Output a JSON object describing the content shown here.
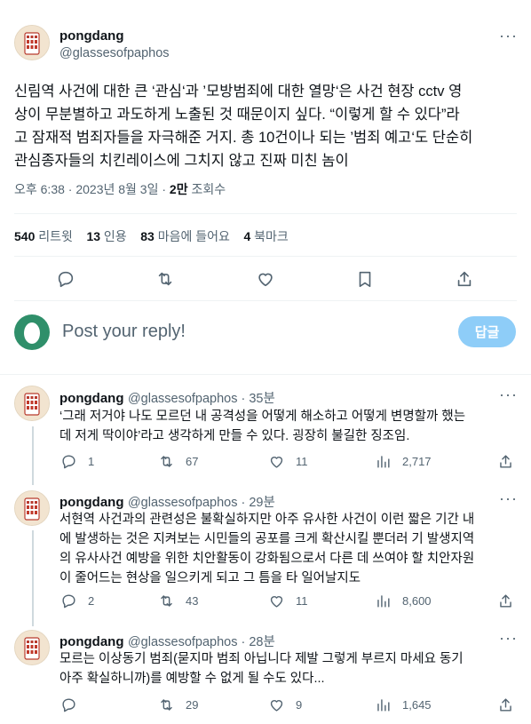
{
  "main_tweet": {
    "name": "pongdang",
    "handle": "@glassesofpaphos",
    "lines": [
      "신림역 사건에 대한 큰 ‘관심‘과 ’모방범죄에 대한 열망‘은 사건 현장 cctv 영",
      "상이 무분별하고 과도하게 노출된 것 때문이지 싶다. “이렇게 할 수 있다”라",
      "고 잠재적 범죄자들을 자극해준 거지. 총 10건이나 되는 ’범죄 예고‘도 단순히",
      "관심종자들의 치킨레이스에 그치지 않고 진짜 미친 놈이"
    ],
    "time": "오후 6:38 · 2023년 8월 3일 · ",
    "views_count": "2만",
    "views_label": " 조회수",
    "stats": {
      "retweets_count": "540",
      "retweets_label": "리트윗",
      "quotes_count": "13",
      "quotes_label": "인용",
      "likes_count": "83",
      "likes_label": "마음에 들어요",
      "bookmarks_count": "4",
      "bookmarks_label": "북마크"
    }
  },
  "compose": {
    "placeholder": "Post your reply!",
    "button_label": "답글"
  },
  "replies": [
    {
      "name": "pongdang",
      "handle": "@glassesofpaphos · 35분",
      "lines": [
        "‘그래 저거야 나도 모르던 내 공격성을 어떻게 해소하고 어떻게 변명할까 했는",
        "데 저게 딱이야’라고 생각하게 만들 수 있다. 굉장히 불길한 징조임."
      ],
      "reply_count": "1",
      "retweet_count": "67",
      "like_count": "11",
      "view_count": "2,717"
    },
    {
      "name": "pongdang",
      "handle": "@glassesofpaphos · 29분",
      "lines": [
        "서현역 사건과의 관련성은 불확실하지만 아주 유사한 사건이 이런 짧은 기간 내",
        "에 발생하는 것은 지켜보는 시민들의 공포를 크게 확산시킬 뿐더러 기 발생지역",
        "의 유사사건 예방을 위한 치안활동이 강화됨으로서 다른 데 쓰여야 할 치안자원",
        "이 줄어드는 현상을 일으키게 되고 그 틈을 타 일어날지도"
      ],
      "reply_count": "2",
      "retweet_count": "43",
      "like_count": "11",
      "view_count": "8,600"
    },
    {
      "name": "pongdang",
      "handle": "@glassesofpaphos · 28분",
      "lines": [
        "모르는 이상동기 범죄(묻지마 범죄 아닙니다 제발 그렇게 부르지 마세요 동기",
        "아주 확실하니까)를 예방할 수 없게 될 수도 있다..."
      ],
      "reply_count": "",
      "retweet_count": "29",
      "like_count": "9",
      "view_count": "1,645"
    }
  ],
  "more_label": "···",
  "colors": {
    "accent": "#1d9bf0",
    "reply_button_disabled": "#8ecdf8",
    "secondary_text": "#536471",
    "divider": "#eff3f4"
  },
  "icons": [
    "more-icon",
    "reply-icon",
    "retweet-icon",
    "like-icon",
    "bookmark-icon",
    "share-icon",
    "views-icon",
    "egg-avatar-icon"
  ]
}
